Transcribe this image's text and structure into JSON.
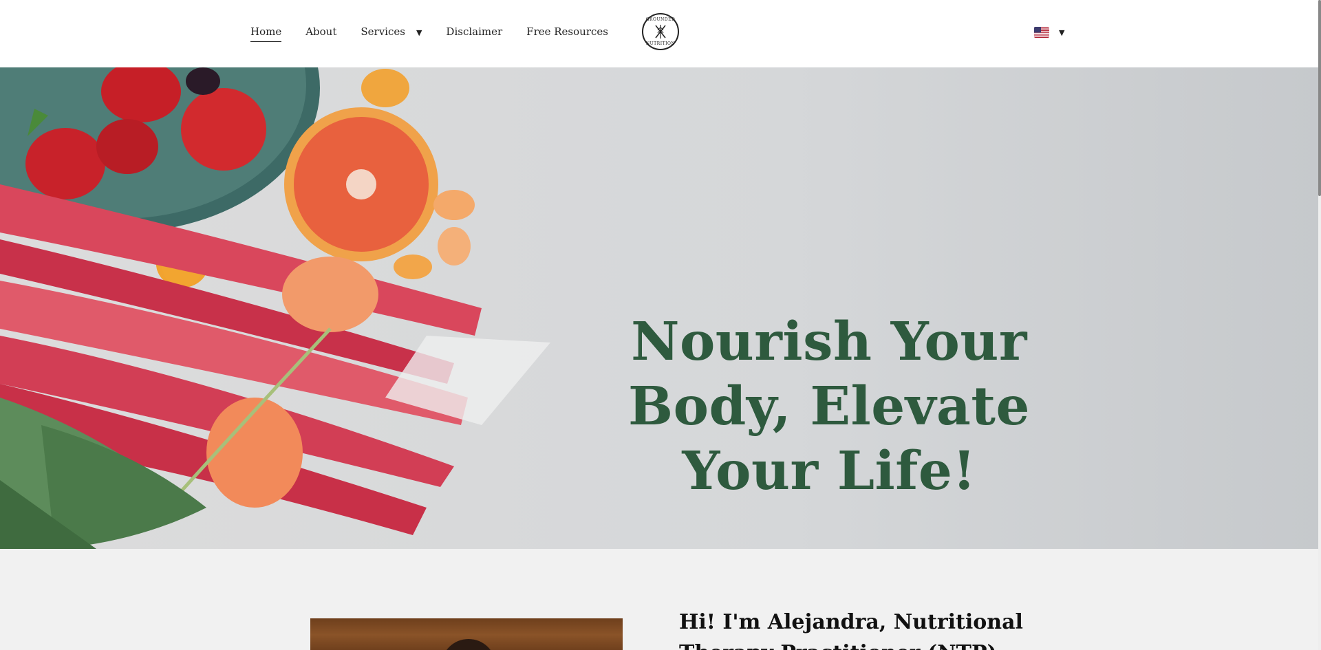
{
  "nav": {
    "items": [
      {
        "label": "Home",
        "active": true
      },
      {
        "label": "About"
      },
      {
        "label": "Services",
        "has_dropdown": true
      },
      {
        "label": "Disclaimer"
      },
      {
        "label": "Free Resources"
      }
    ]
  },
  "logo": {
    "top_text": "GROUNDED",
    "bottom_text": "NUTRITION",
    "icon": "crossed-utensils-wheat-icon"
  },
  "language": {
    "flag": "us-flag-icon"
  },
  "hero": {
    "title": "Nourish Your Body, Elevate Your Life!",
    "title_color": "#2e5a3e"
  },
  "about": {
    "heading": "Hi! I'm Alejandra, Nutritional Therapy Practitioner (NTP)"
  }
}
